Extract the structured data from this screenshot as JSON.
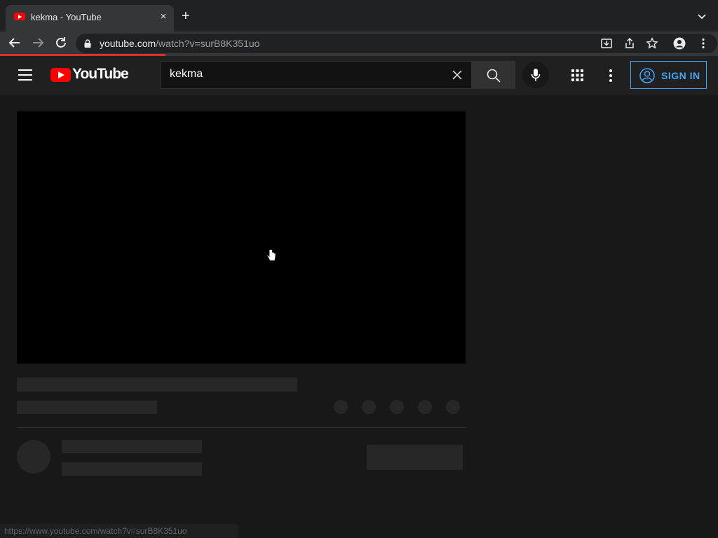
{
  "browser": {
    "tab_title": "kekma - YouTube",
    "tab_close": "×",
    "new_tab": "+",
    "url_host": "youtube.com",
    "url_path": "/watch?v=surB8K351uo",
    "load_progress": 0.23
  },
  "youtube": {
    "logo_text": "YouTube",
    "search_value": "kekma",
    "sign_in_label": "SIGN IN"
  },
  "status_bar": {
    "text": "https://www.youtube.com/watch?v=surB8K351uo"
  },
  "colors": {
    "brand_red": "#ff0000",
    "accent_blue": "#3ea6ff",
    "page_bg": "#181818",
    "header_bg": "#202020",
    "placeholder": "#272727"
  }
}
